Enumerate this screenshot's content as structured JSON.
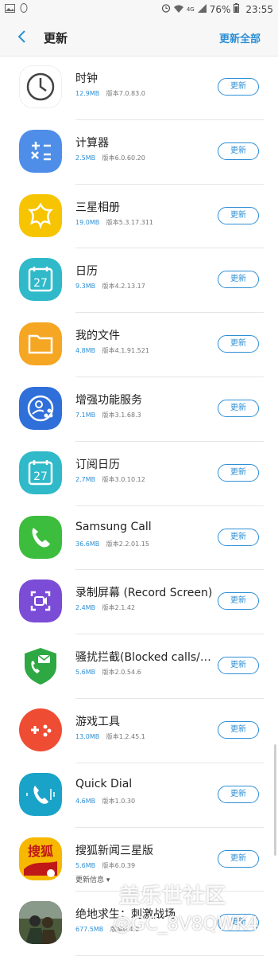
{
  "status_bar": {
    "battery": "76%",
    "time": "23:55",
    "network": "4G"
  },
  "header": {
    "title": "更新",
    "update_all": "更新全部"
  },
  "update_button_label": "更新",
  "apps": [
    {
      "name": "时钟",
      "size": "12.9MB",
      "version": "版本7.0.83.0",
      "icon": "clock-icon",
      "color": "#ffffff"
    },
    {
      "name": "计算器",
      "size": "2.5MB",
      "version": "版本6.0.60.20",
      "icon": "calculator-icon",
      "color": "#4e8ee8"
    },
    {
      "name": "三星相册",
      "size": "19.0MB",
      "version": "版本5.3.17.311",
      "icon": "gallery-flower-icon",
      "color": "#f6c400"
    },
    {
      "name": "日历",
      "size": "9.3MB",
      "version": "版本4.2.13.17",
      "icon": "calendar-icon",
      "color": "#2fb9c9"
    },
    {
      "name": "我的文件",
      "size": "4.8MB",
      "version": "版本4.1.91.521",
      "icon": "folder-icon",
      "color": "#f5a623"
    },
    {
      "name": "增强功能服务",
      "size": "7.1MB",
      "version": "版本3.1.68.3",
      "icon": "enhanced-features-icon",
      "color": "#2f6fd9"
    },
    {
      "name": "订阅日历",
      "size": "2.7MB",
      "version": "版本3.0.10.12",
      "icon": "calendar-icon",
      "color": "#2fb9c9"
    },
    {
      "name": "Samsung Call",
      "size": "36.6MB",
      "version": "版本2.2.01.15",
      "icon": "phone-call-icon",
      "color": "#3dbd3d"
    },
    {
      "name": "录制屏幕 (Record Screen)",
      "size": "2.4MB",
      "version": "版本2.1.42",
      "icon": "screen-record-icon",
      "color": "#7b4cd6"
    },
    {
      "name": "骚扰拦截(Blocked calls/m...",
      "size": "5.6MB",
      "version": "版本2.0.54.6",
      "icon": "shield-phone-icon",
      "color": "#2da843"
    },
    {
      "name": "游戏工具",
      "size": "13.0MB",
      "version": "版本1.2.45.1",
      "icon": "game-pad-icon",
      "color": "#ef4c34"
    },
    {
      "name": "Quick Dial",
      "size": "4.6MB",
      "version": "版本1.0.30",
      "icon": "quick-dial-icon",
      "color": "#1aa3c8"
    },
    {
      "name": "搜狐新闻三星版",
      "size": "5.6MB",
      "version": "版本6.0.39",
      "icon": "sohu-news-icon",
      "color": "#f6b800",
      "whats_new": "更新信息"
    },
    {
      "name": "绝地求生：刺激战场",
      "size": "677.5MB",
      "version": "版本0.4.0",
      "icon": "pubg-game-icon",
      "color": "#4a5a3a"
    }
  ],
  "watermark": {
    "text1": "盖乐世社区",
    "text2": "@GC_8V8QWK4"
  }
}
